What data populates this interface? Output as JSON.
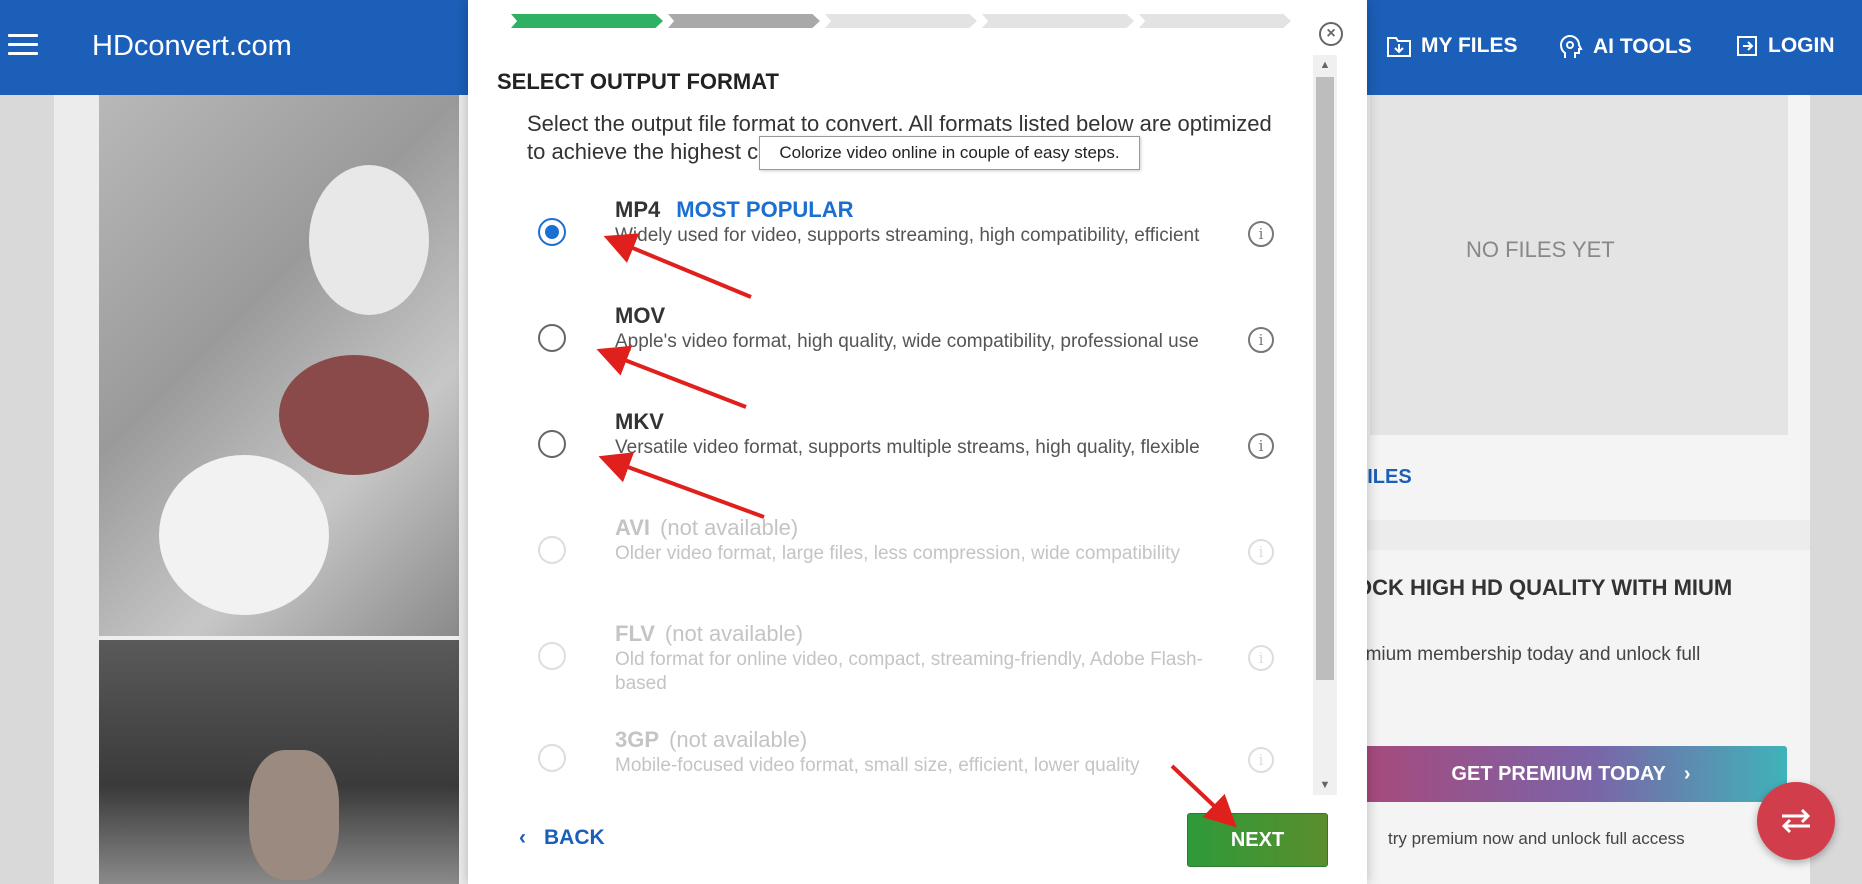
{
  "header": {
    "logo": "HDconvert.com",
    "nav": {
      "my_files": "MY FILES",
      "ai_tools": "AI TOOLS",
      "login": "LOGIN"
    }
  },
  "side": {
    "no_files": "NO FILES YET",
    "files_link": "FILES",
    "premium_title": "OCK HIGH HD QUALITY WITH MIUM",
    "premium_desc": "emium membership today and unlock full",
    "premium_button": "GET PREMIUM TODAY",
    "premium_note": "try premium now and unlock full access"
  },
  "modal": {
    "title": "SELECT OUTPUT FORMAT",
    "description": "Select the output file format to convert. All formats listed below are optimized to achieve the highest conversion speeds.",
    "tooltip": "Colorize video online in couple of easy steps.",
    "formats": [
      {
        "name": "MP4",
        "badge": "MOST POPULAR",
        "note": "",
        "desc": "Widely used for video, supports streaming, high compatibility, efficient",
        "selected": true,
        "available": true
      },
      {
        "name": "MOV",
        "badge": "",
        "note": "",
        "desc": "Apple's video format, high quality, wide compatibility, professional use",
        "selected": false,
        "available": true
      },
      {
        "name": "MKV",
        "badge": "",
        "note": "",
        "desc": "Versatile video format, supports multiple streams, high quality, flexible",
        "selected": false,
        "available": true
      },
      {
        "name": "AVI",
        "badge": "",
        "note": "(not available)",
        "desc": "Older video format, large files, less compression, wide compatibility",
        "selected": false,
        "available": false
      },
      {
        "name": "FLV",
        "badge": "",
        "note": "(not available)",
        "desc": "Old format for online video, compact, streaming-friendly, Adobe Flash-based",
        "selected": false,
        "available": false
      },
      {
        "name": "3GP",
        "badge": "",
        "note": "(not available)",
        "desc": "Mobile-focused video format, small size, efficient, lower quality",
        "selected": false,
        "available": false
      }
    ],
    "back_label": "BACK",
    "next_label": "NEXT",
    "progress_steps": [
      "done",
      "current",
      "todo",
      "todo",
      "todo"
    ]
  },
  "colors": {
    "brand": "#1b5fb8",
    "selected": "#1b6fd0",
    "progress_done": "#2eb163",
    "annotation_arrow": "#e0201c"
  },
  "icons": [
    "menu-icon",
    "folder-download-icon",
    "ai-brain-icon",
    "login-icon",
    "close-icon",
    "info-icon",
    "chevron-left-icon",
    "chevron-right-icon",
    "swap-arrows-icon"
  ]
}
